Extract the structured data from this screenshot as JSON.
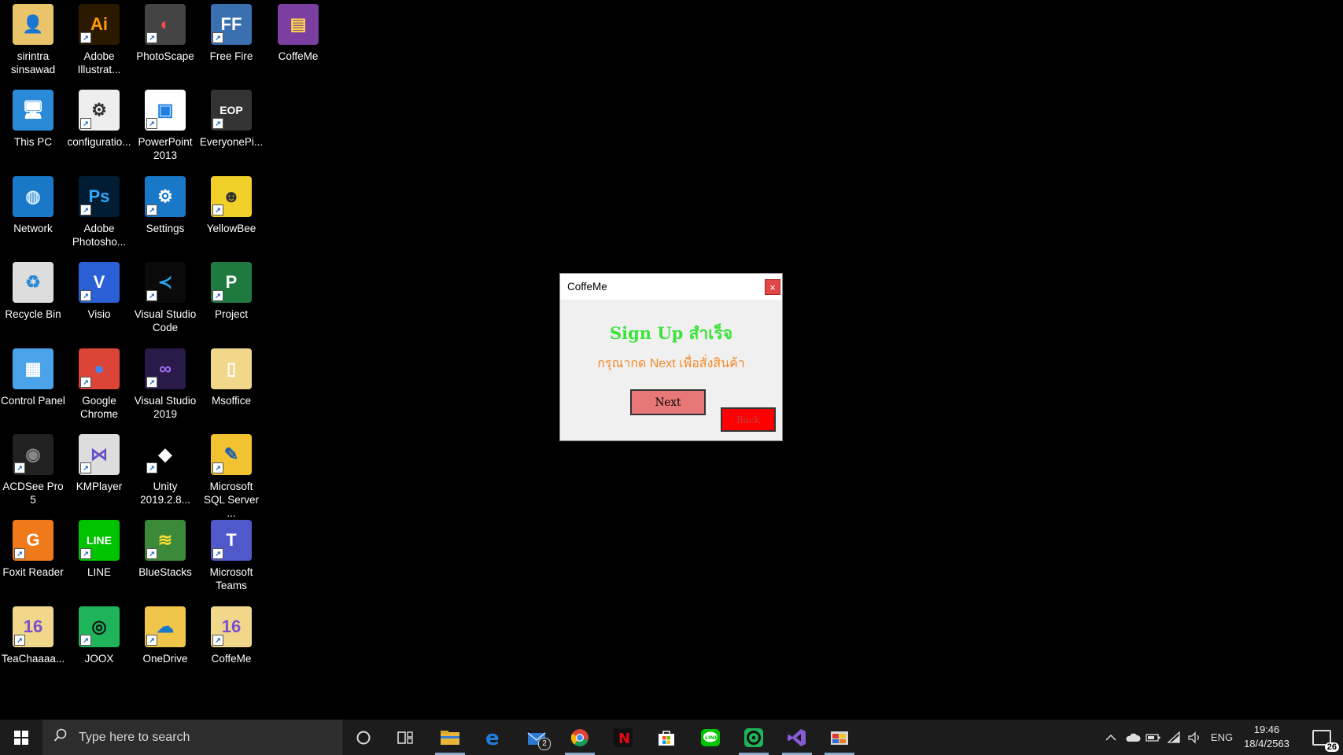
{
  "desktop": {
    "icons": [
      {
        "label": "sirintra sinsawad",
        "icon": "user-folder-icon"
      },
      {
        "label": "Adobe Illustrat...",
        "icon": "illustrator-icon"
      },
      {
        "label": "PhotoScape",
        "icon": "photoscape-icon"
      },
      {
        "label": "Free Fire",
        "icon": "free-fire-icon"
      },
      {
        "label": "CoffeMe",
        "icon": "winrar-archive-icon"
      },
      {
        "label": "This PC",
        "icon": "computer-icon"
      },
      {
        "label": "configuratio...",
        "icon": "config-file-icon"
      },
      {
        "label": "PowerPoint 2013",
        "icon": "powerpoint-icon"
      },
      {
        "label": "EveryonePi...",
        "icon": "everyonepiano-icon"
      },
      {
        "label": "Network",
        "icon": "network-icon"
      },
      {
        "label": "Adobe Photosho...",
        "icon": "photoshop-icon"
      },
      {
        "label": "Settings",
        "icon": "settings-gear-icon"
      },
      {
        "label": "YellowBee",
        "icon": "yellowbee-icon"
      },
      {
        "label": "Recycle Bin",
        "icon": "recycle-bin-icon"
      },
      {
        "label": "Visio",
        "icon": "visio-icon"
      },
      {
        "label": "Visual Studio Code",
        "icon": "vscode-icon"
      },
      {
        "label": "Project",
        "icon": "ms-project-icon"
      },
      {
        "label": "Control Panel",
        "icon": "control-panel-icon"
      },
      {
        "label": "Google Chrome",
        "icon": "chrome-icon"
      },
      {
        "label": "Visual Studio 2019",
        "icon": "visual-studio-icon"
      },
      {
        "label": "Msoffice",
        "icon": "folder-icon"
      },
      {
        "label": "ACDSee Pro 5",
        "icon": "acdsee-camera-icon"
      },
      {
        "label": "KMPlayer",
        "icon": "kmplayer-icon"
      },
      {
        "label": "Unity 2019.2.8...",
        "icon": "unity-icon"
      },
      {
        "label": "Microsoft SQL Server ...",
        "icon": "sql-server-icon"
      },
      {
        "label": "Foxit Reader",
        "icon": "foxit-pdf-icon"
      },
      {
        "label": "LINE",
        "icon": "line-icon"
      },
      {
        "label": "BlueStacks",
        "icon": "bluestacks-icon"
      },
      {
        "label": "Microsoft Teams",
        "icon": "teams-icon"
      },
      {
        "label": "TeaChaaaa...",
        "icon": "vs-solution-folder-icon"
      },
      {
        "label": "JOOX",
        "icon": "joox-icon"
      },
      {
        "label": "OneDrive",
        "icon": "onedrive-folder-icon"
      },
      {
        "label": "CoffeMe",
        "icon": "vs-solution-folder-icon"
      }
    ]
  },
  "dialog": {
    "title": "CoffeMe",
    "close_label": "×",
    "heading": "Sign Up สำเร็จ",
    "subtext": "กรุณากด Next เพื่อสั่งสินค้า",
    "next_label": "Next",
    "back_label": "Back"
  },
  "taskbar": {
    "search_placeholder": "Type here to search",
    "mail_badge": "2",
    "language": "ENG",
    "time": "19:46",
    "date": "18/4/2563",
    "notification_count": "26"
  },
  "colors": {
    "heading_green": "#3de33d",
    "subtext_orange": "#f08a2a",
    "next_button": "#e87878",
    "back_button": "#ff0000",
    "close_button": "#e04848"
  }
}
